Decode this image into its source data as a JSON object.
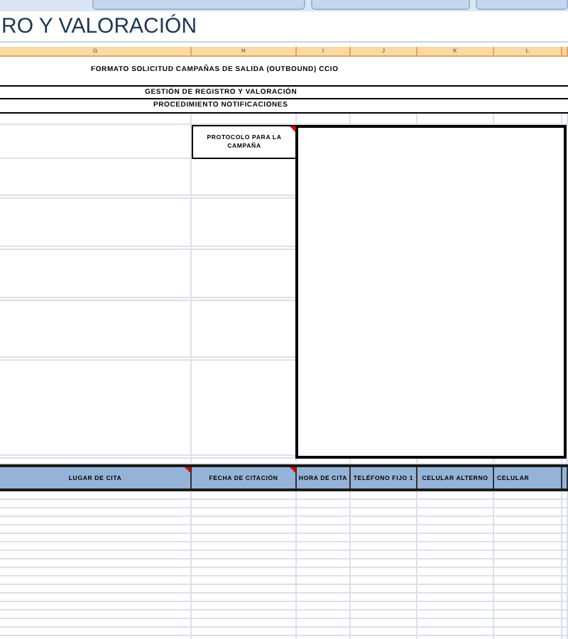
{
  "toolbar": {
    "dropdowns": [
      {
        "kind": "dropdown"
      },
      {
        "kind": "dropdown"
      },
      {
        "kind": "dropdown"
      }
    ]
  },
  "title_bar": {
    "text": "RO Y VALORACIÓN"
  },
  "column_headers": [
    "G",
    "H",
    "I",
    "J",
    "K",
    "L"
  ],
  "sheet": {
    "heading": "FORMATO SOLICITUD CAMPAÑAS DE SALIDA (OUTBOUND) CCIO",
    "subheadings": [
      "GESTIÓN DE REGISTRO Y VALORACIÓN",
      "PROCEDIMIENTO NOTIFICACIONES"
    ],
    "protocol_label": {
      "text": "PROTOCOLO PARA LA CAMPAÑA",
      "comment": true
    }
  },
  "table": {
    "columns": [
      {
        "label": "LUGAR DE CITA",
        "comment": true
      },
      {
        "label": "FECHA DE CITACIÓN",
        "comment": true
      },
      {
        "label": "HORA DE CITA",
        "comment": false
      },
      {
        "label": "TELÉFONO FIJO 1",
        "comment": false
      },
      {
        "label": "CELULAR ALTERNO",
        "comment": false
      },
      {
        "label": "CELULAR",
        "comment": false
      }
    ]
  }
}
